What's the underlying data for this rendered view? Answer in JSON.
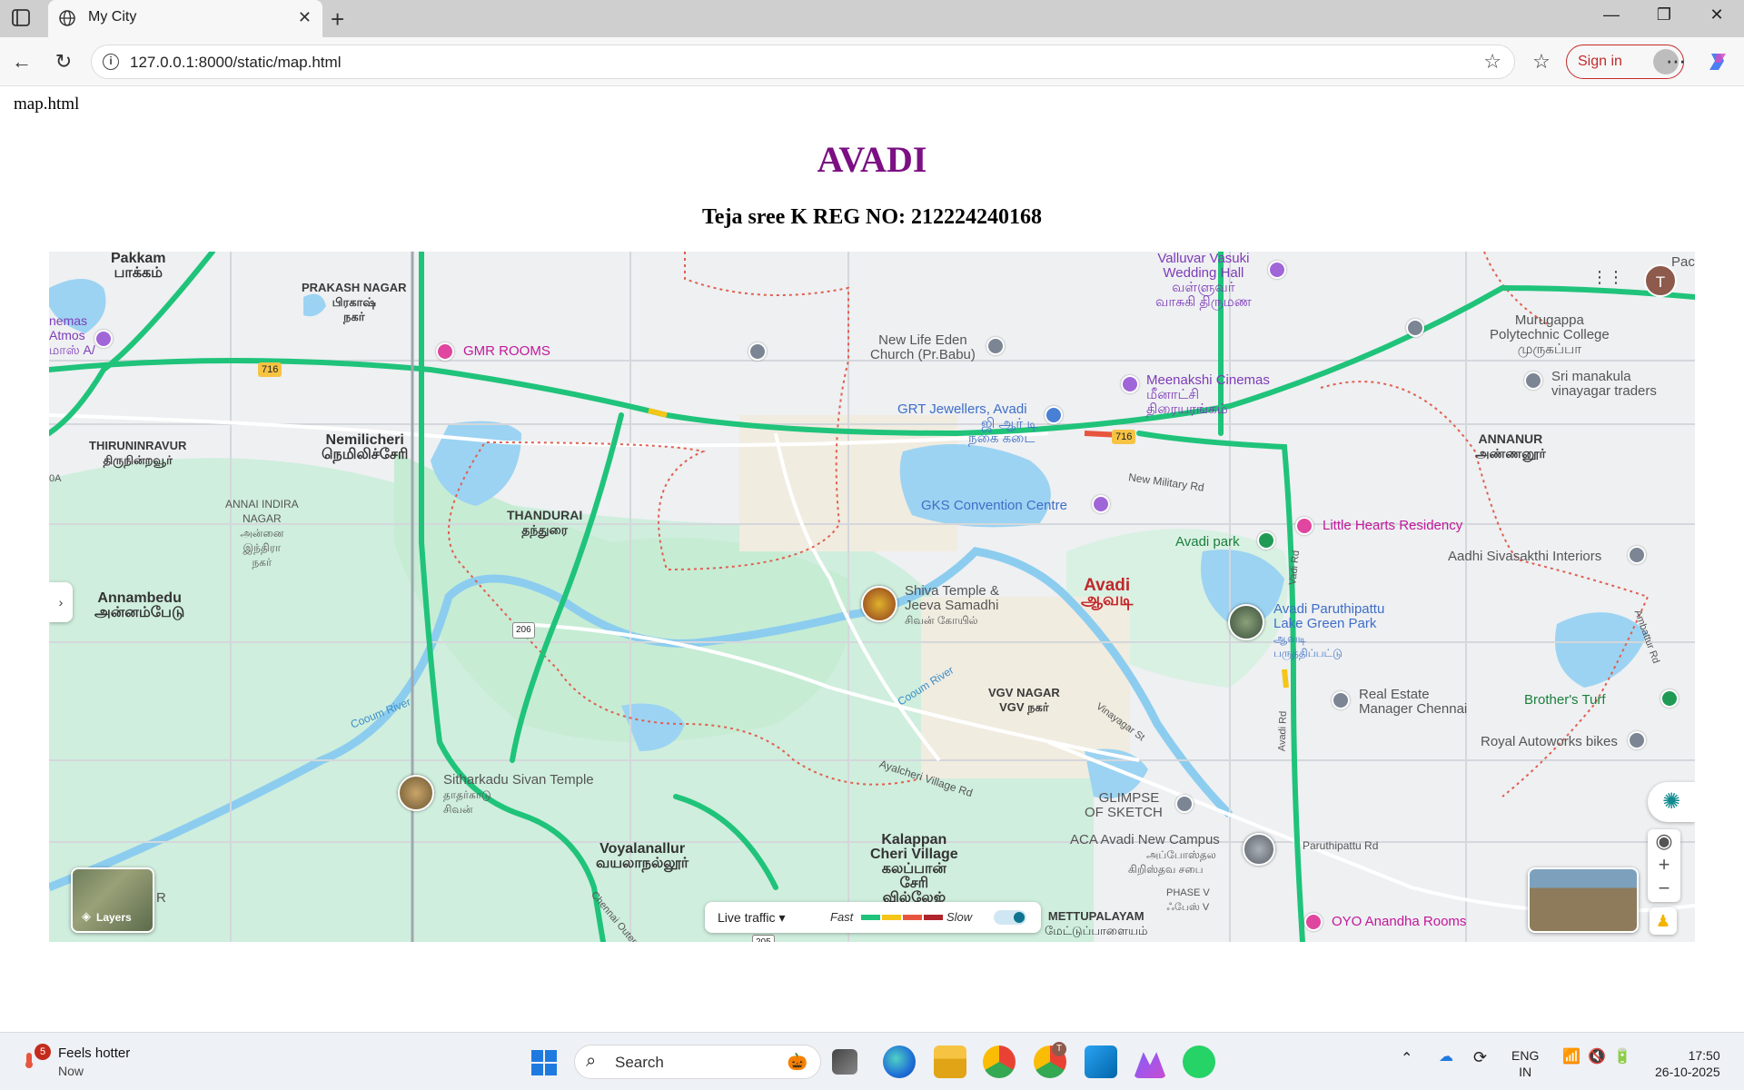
{
  "browser": {
    "tab_title": "My City",
    "url": "127.0.0.1:8000/static/map.html",
    "signin_label": "Sign in"
  },
  "page": {
    "file_label": "map.html",
    "heading": "AVADI",
    "subheading": "Teja sree K REG NO: 212224240168"
  },
  "map": {
    "places": {
      "pakkam": "Pakkam",
      "pakkam_ta": "பாக்கம்",
      "prakash_nagar": "PRAKASH NAGAR",
      "prakash_nagar_ta1": "பிரகாஷ்",
      "prakash_nagar_ta2": "நகர்",
      "cinemas_a": "nemas",
      "cinemas_b": "Atmos",
      "cinemas_c": "மாஸ் A/",
      "thiruninravur": "THIRUNINRAVUR",
      "thiruninravur_ta": "திருநின்றவூர்",
      "nemilicheri": "Nemilicheri",
      "nemilicheri_ta": "நெமிலிச்சேரி",
      "thandurai": "THANDURAI",
      "thandurai_ta": "தந்துரை",
      "annai_indira_a": "ANNAI INDIRA",
      "annai_indira_b": "NAGAR",
      "annai_indira_ta1": "அன்னை",
      "annai_indira_ta2": "இந்திரா",
      "annai_indira_ta3": "நகர்",
      "annambedu": "Annambedu",
      "annambedu_ta": "அன்னம்பேடு",
      "gmr_rooms": "GMR ROOMS",
      "valluvar_a": "Valluvar Vasuki",
      "valluvar_b": "Wedding Hall",
      "valluvar_ta1": "வள்ளுவர்",
      "valluvar_ta2": "வாசுகி திருமண",
      "murugappa_a": "Murugappa",
      "murugappa_b": "Polytechnic College",
      "murugappa_ta": "முருகப்பா",
      "newlife_a": "New Life Eden",
      "newlife_b": "Church (Pr.Babu)",
      "grt_a": "GRT Jewellers, Avadi",
      "grt_ta1": "ஜி ஆர் டி",
      "grt_ta2": "நகை கடை",
      "meenakshi_a": "Meenakshi Cinemas",
      "meenakshi_ta1": "மீனாட்சி",
      "meenakshi_ta2": "திரையரங்கம்",
      "sri_manakula_a": "Sri manakula",
      "sri_manakula_b": "vinayagar traders",
      "annanur": "ANNANUR",
      "annanur_ta": "அண்ணனூர்",
      "new_military_rd": "New Military Rd",
      "gks": "GKS Convention Centre",
      "avadi_park": "Avadi park",
      "little_hearts": "Little Hearts Residency",
      "aadhi_sivasakthi": "Aadhi Sivasakthi Interiors",
      "shiva_a": "Shiva Temple &",
      "shiva_b": "Jeeva Samadhi",
      "shiva_ta": "சிவன் கோயில்",
      "avadi": "Avadi",
      "avadi_ta": "ஆவடி",
      "paruthipattu_a": "Avadi Paruthipattu",
      "paruthipattu_b": "Lake Green Park",
      "paruthipattu_ta1": "ஆவடி",
      "paruthipattu_ta2": "பருத்திப்பட்டு",
      "vadi_rd": "Vadi Rd",
      "cooum_river_w": "Cooum River",
      "cooum_river_e": "Cooum River",
      "vgv_nagar": "VGV NAGAR",
      "vgv_nagar_ta": "VGV நகர்",
      "real_estate_a": "Real Estate",
      "real_estate_b": "Manager Chennai",
      "brothers_turf": "Brother's Turf",
      "royal_autoworks": "Royal Autoworks bikes",
      "ambattur_rd": "Ambattur Rd",
      "vinayagar_st": "Vinayagar St",
      "ayalcheri_rd": "Ayalcheri Village Rd",
      "sitharkadu_a": "Sitharkadu Sivan Temple",
      "sitharkadu_ta1": "தாதர்காடு",
      "sitharkadu_ta2": "சிவன்",
      "voyalanallur": "Voyalanallur",
      "voyalanallur_ta": "வயலாநல்லூர்",
      "kalappan_a": "Kalappan",
      "kalappan_b": "Cheri Village",
      "kalappan_ta1": "கலப்பான்",
      "kalappan_ta2": "சேரி",
      "kalappan_ta3": "வில்லேஜ்",
      "glimpse_a": "GLIMPSE",
      "glimpse_b": "OF SKETCH",
      "aca_a": "ACA Avadi New Campus",
      "aca_ta1": "அப்போஸ்தல",
      "aca_ta2": "கிறிஸ்தவ சபை",
      "paruthipattu_rd": "Paruthipattu Rd",
      "avadi_rd": "Avadi Rd",
      "phase_v": "PHASE V",
      "phase_v_ta": "ஃபேஸ் V",
      "mettupalayam": "METTUPALAYAM",
      "mettupalayam_ta": "மேட்டுப்பாளையம்",
      "oyo": "OYO Anandha Rooms",
      "chennai_outer": "Chennai Outer R",
      "pac": "Pac",
      "r_edge": "R",
      "oa_edge": "0A",
      "route_716a": "716",
      "route_716b": "716",
      "route_206": "206",
      "route_205": "205"
    },
    "controls": {
      "layers_label": "Layers",
      "live_traffic": "Live traffic",
      "fast": "Fast",
      "slow": "Slow",
      "account_initial": "T",
      "traffic_colors": [
        "#1fc37a",
        "#f5c518",
        "#e8553f",
        "#b0232a"
      ]
    }
  },
  "taskbar": {
    "weather_title": "Feels hotter",
    "weather_sub": "Now",
    "weather_badge": "5",
    "search_placeholder": "Search",
    "lang_1": "ENG",
    "lang_2": "IN",
    "time": "17:50",
    "date": "26-10-2025",
    "chrome_badge": "T"
  }
}
